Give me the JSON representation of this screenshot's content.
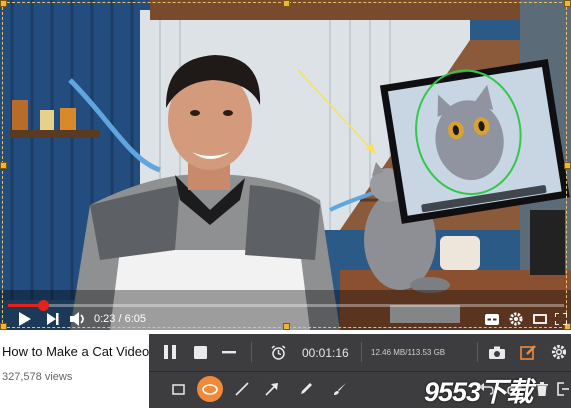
{
  "player": {
    "current_time": "0:23",
    "duration": "6:05",
    "time_display": "0:23 / 6:05",
    "progress_fraction": 0.063
  },
  "video_info": {
    "title": "How to Make a Cat Video",
    "views": "327,578 views"
  },
  "recorder": {
    "elapsed": "00:01:16",
    "file_size": "12.46 MB/113.53 GB",
    "active_tool": "ellipse",
    "accent_color": "#f08a3a"
  },
  "watermark": "9553下载"
}
